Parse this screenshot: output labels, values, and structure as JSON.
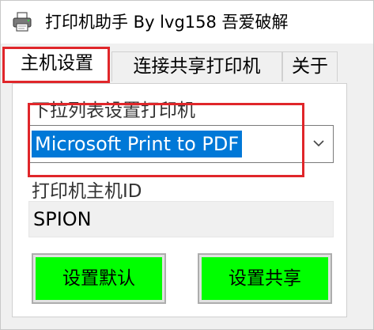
{
  "window": {
    "title": "打印机助手 By lvg158 吾爱破解"
  },
  "tabs": [
    {
      "label": "主机设置",
      "active": true
    },
    {
      "label": "连接共享打印机",
      "active": false
    },
    {
      "label": "关于",
      "active": false
    }
  ],
  "host_tab": {
    "dropdown_label": "下拉列表设置打印机",
    "selected_printer": "Microsoft Print to PDF",
    "host_id_label": "打印机主机ID",
    "host_id_value": "SPION",
    "set_default_button": "设置默认",
    "set_share_button": "设置共享"
  },
  "colors": {
    "button_fill": "#00ff00",
    "annotation_border": "#e0262a",
    "selection": "#0078d7"
  },
  "icons": {
    "app": "printer-icon",
    "dropdown": "chevron-down-icon"
  }
}
